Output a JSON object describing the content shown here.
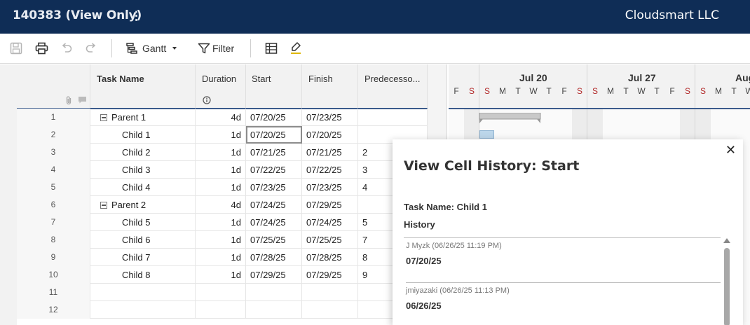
{
  "header": {
    "title": "140383 (View Only)",
    "company": "Cloudsmart LLC"
  },
  "toolbar": {
    "view_label": "Gantt",
    "filter_label": "Filter"
  },
  "grid": {
    "columns": {
      "task": "Task Name",
      "duration": "Duration",
      "start": "Start",
      "finish": "Finish",
      "pred": "Predecesso..."
    },
    "rows": [
      {
        "num": "1",
        "task": "Parent 1",
        "parent": true,
        "duration": "4d",
        "start": "07/20/25",
        "finish": "07/23/25",
        "pred": ""
      },
      {
        "num": "2",
        "task": "Child 1",
        "parent": false,
        "duration": "1d",
        "start": "07/20/25",
        "finish": "07/20/25",
        "pred": ""
      },
      {
        "num": "3",
        "task": "Child 2",
        "parent": false,
        "duration": "1d",
        "start": "07/21/25",
        "finish": "07/21/25",
        "pred": "2"
      },
      {
        "num": "4",
        "task": "Child 3",
        "parent": false,
        "duration": "1d",
        "start": "07/22/25",
        "finish": "07/22/25",
        "pred": "3"
      },
      {
        "num": "5",
        "task": "Child 4",
        "parent": false,
        "duration": "1d",
        "start": "07/23/25",
        "finish": "07/23/25",
        "pred": "4"
      },
      {
        "num": "6",
        "task": "Parent 2",
        "parent": true,
        "duration": "4d",
        "start": "07/24/25",
        "finish": "07/29/25",
        "pred": ""
      },
      {
        "num": "7",
        "task": "Child 5",
        "parent": false,
        "duration": "1d",
        "start": "07/24/25",
        "finish": "07/24/25",
        "pred": "5"
      },
      {
        "num": "8",
        "task": "Child 6",
        "parent": false,
        "duration": "1d",
        "start": "07/25/25",
        "finish": "07/25/25",
        "pred": "7"
      },
      {
        "num": "9",
        "task": "Child 7",
        "parent": false,
        "duration": "1d",
        "start": "07/28/25",
        "finish": "07/28/25",
        "pred": "8"
      },
      {
        "num": "10",
        "task": "Child 8",
        "parent": false,
        "duration": "1d",
        "start": "07/29/25",
        "finish": "07/29/25",
        "pred": "9"
      },
      {
        "num": "11",
        "task": "",
        "parent": false,
        "duration": "",
        "start": "",
        "finish": "",
        "pred": ""
      },
      {
        "num": "12",
        "task": "",
        "parent": false,
        "duration": "",
        "start": "",
        "finish": "",
        "pred": ""
      }
    ]
  },
  "gantt": {
    "weeks": [
      "Jul 20",
      "Jul 27",
      "Aug"
    ],
    "days": [
      "F",
      "S",
      "S",
      "M",
      "T",
      "W",
      "T",
      "F",
      "S",
      "S",
      "M",
      "T",
      "W",
      "T",
      "F",
      "S",
      "S",
      "M",
      "T",
      "W"
    ]
  },
  "dialog": {
    "title": "View Cell History: Start",
    "task_line": "Task Name: Child 1",
    "history_label": "History",
    "entries": [
      {
        "meta": "J Myzk (06/26/25 11:19 PM)",
        "value": "07/20/25"
      },
      {
        "meta": "jmiyazaki (06/26/25 11:13 PM)",
        "value": "06/26/25"
      }
    ]
  }
}
